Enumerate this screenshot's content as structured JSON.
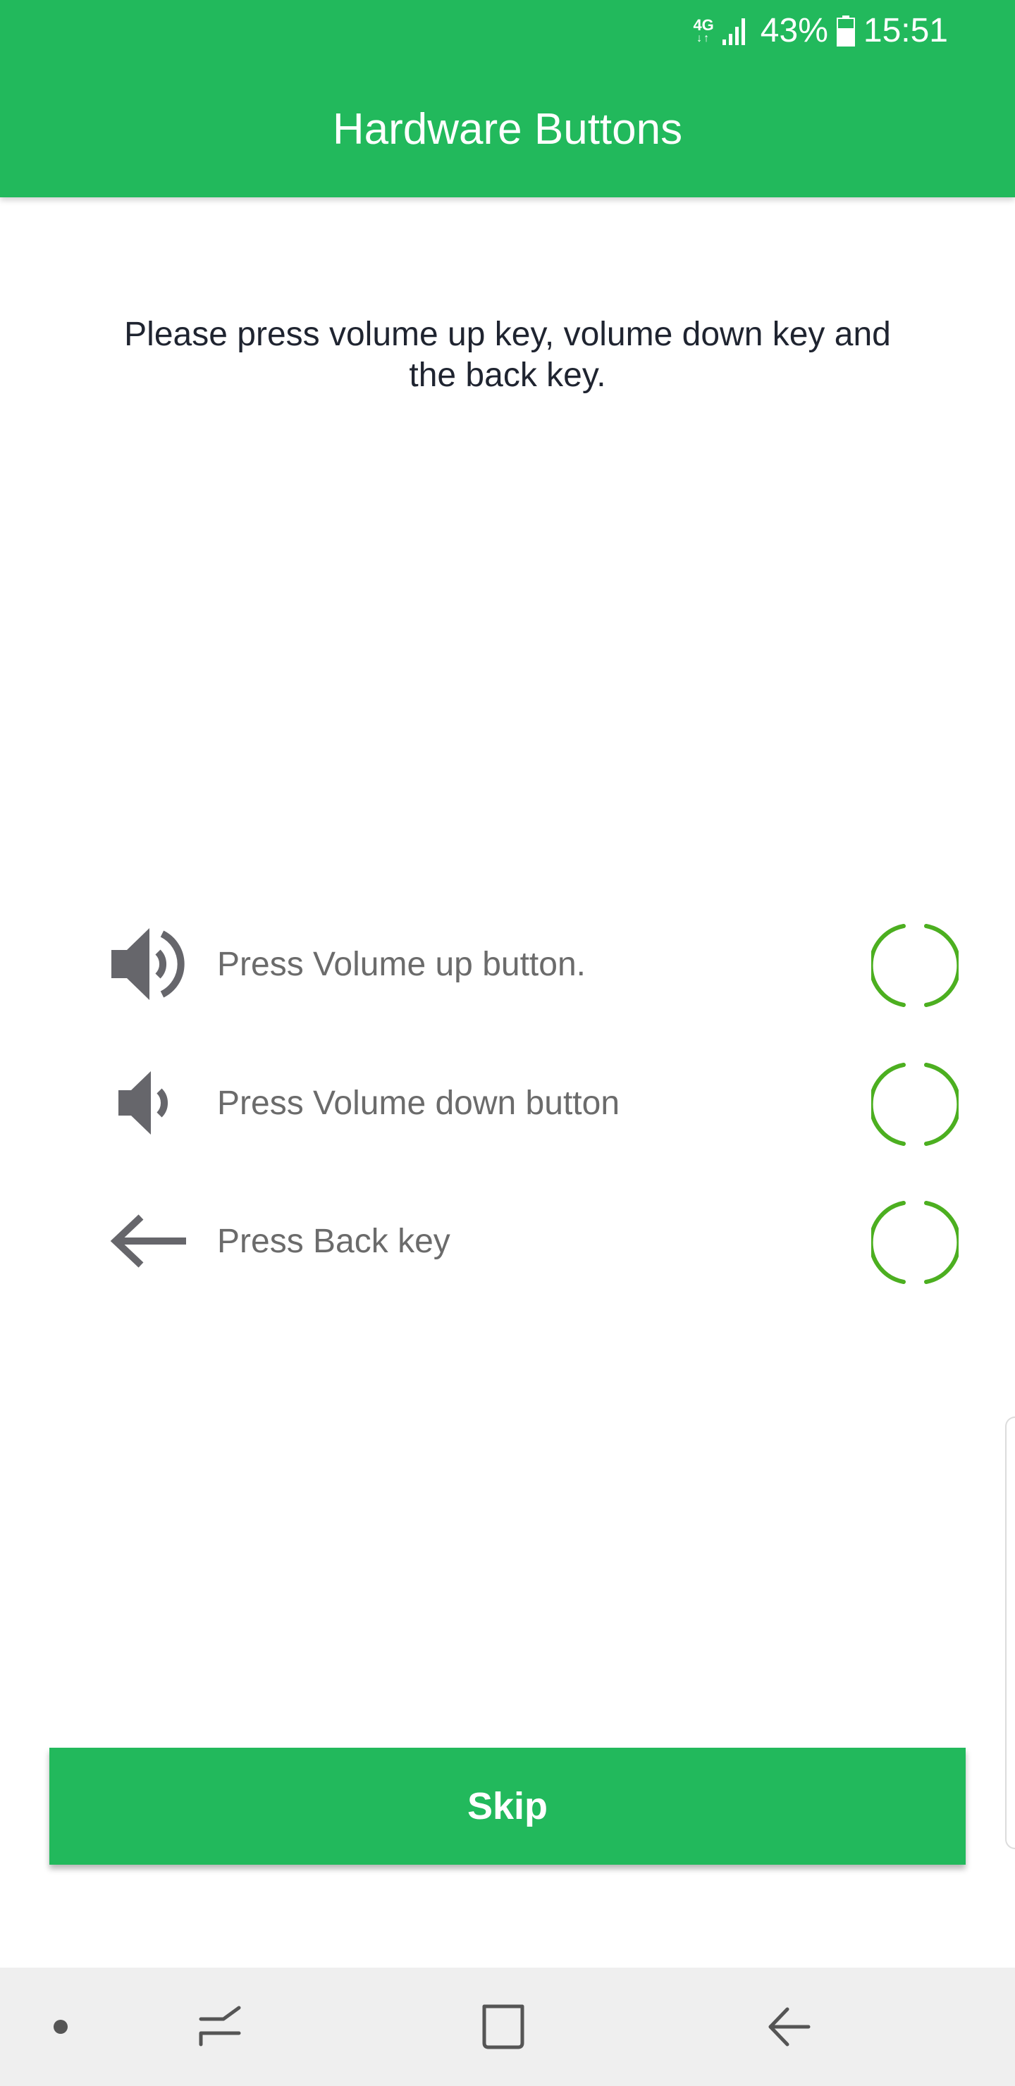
{
  "status_bar": {
    "network": "4G",
    "network_arrows": "↓↑",
    "battery_percent": "43%",
    "time": "15:51"
  },
  "app_bar": {
    "title": "Hardware Buttons"
  },
  "instruction": "Please press volume up key, volume down key and the back key.",
  "checks": [
    {
      "label": "Press Volume up button.",
      "icon": "volume-up-icon",
      "status": "pending"
    },
    {
      "label": "Press Volume down button",
      "icon": "volume-down-icon",
      "status": "pending"
    },
    {
      "label": "Press Back key",
      "icon": "back-arrow-icon",
      "status": "pending"
    }
  ],
  "skip_button": {
    "label": "Skip"
  },
  "colors": {
    "brand_green": "#22b95c",
    "status_ring_green": "#4caf20",
    "icon_gray": "#66666b",
    "nav_bar_bg": "#efefef"
  },
  "navigation_bar": {
    "icons": [
      "dot-indicator-icon",
      "recent-apps-icon",
      "home-icon",
      "back-icon"
    ]
  }
}
